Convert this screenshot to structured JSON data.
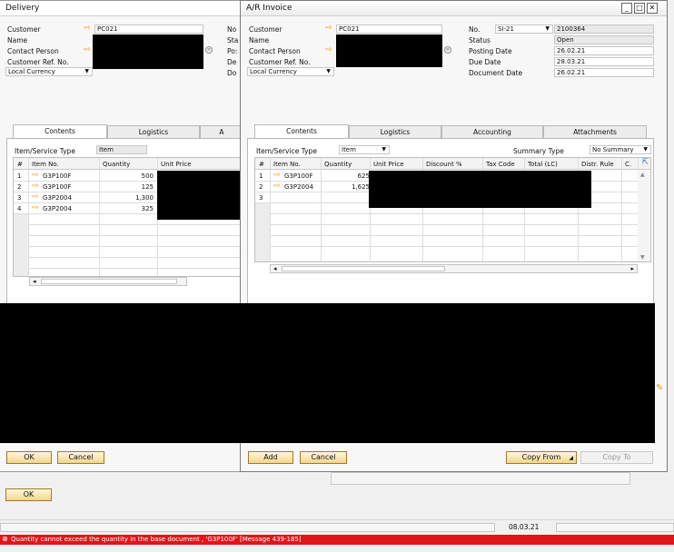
{
  "delivery": {
    "title": "Delivery",
    "labels": {
      "customer": "Customer",
      "name": "Name",
      "contact": "Contact Person",
      "ref": "Customer Ref. No.",
      "currency": "Local Currency"
    },
    "customer_value": "PC021",
    "right_labels": [
      "No",
      "Sta",
      "Po:",
      "De",
      "Do"
    ],
    "tabs": [
      "Contents",
      "Logistics",
      "A"
    ],
    "item_type_label": "Item/Service Type",
    "item_type_value": "Item",
    "columns": [
      "#",
      "Item No.",
      "Quantity",
      "Unit Price"
    ],
    "rows": [
      {
        "n": "1",
        "item": "G3P100F",
        "qty": "500"
      },
      {
        "n": "2",
        "item": "G3P100F",
        "qty": "125"
      },
      {
        "n": "3",
        "item": "G3P2004",
        "qty": "1,300"
      },
      {
        "n": "4",
        "item": "G3P2004",
        "qty": "325"
      }
    ],
    "ok": "OK",
    "cancel": "Cancel"
  },
  "invoice": {
    "title": "A/R Invoice",
    "labels": {
      "customer": "Customer",
      "name": "Name",
      "contact": "Contact Person",
      "ref": "Customer Ref. No.",
      "currency": "Local Currency"
    },
    "customer_value": "PC021",
    "right": {
      "no_label": "No.",
      "series": "SI-21",
      "no_value": "2100364",
      "status_label": "Status",
      "status_value": "Open",
      "posting_label": "Posting Date",
      "posting_value": "26.02.21",
      "due_label": "Due Date",
      "due_value": "28.03.21",
      "doc_label": "Document Date",
      "doc_value": "26.02.21"
    },
    "tabs": [
      "Contents",
      "Logistics",
      "Accounting",
      "Attachments"
    ],
    "item_type_label": "Item/Service Type",
    "item_type_value": "Item",
    "summary_label": "Summary Type",
    "summary_value": "No Summary",
    "columns": [
      "#",
      "Item No.",
      "Quantity",
      "Unit Price",
      "Discount %",
      "Tax Code",
      "Total (LC)",
      "Distr. Rule",
      "C."
    ],
    "rows": [
      {
        "n": "1",
        "item": "G3P100F",
        "qty": "625"
      },
      {
        "n": "2",
        "item": "G3P2004",
        "qty": "1,625"
      },
      {
        "n": "3",
        "item": "",
        "qty": ""
      }
    ],
    "add": "Add",
    "cancel": "Cancel",
    "copy_from": "Copy From",
    "copy_to": "Copy To"
  },
  "bottom_ok": "OK",
  "status_date": "08.03.21",
  "error": "Quantity cannot exceed the quantity in the base document , 'G3P100F' [Message 439-185]"
}
